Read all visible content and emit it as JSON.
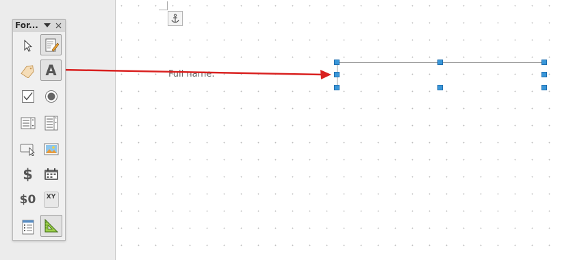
{
  "toolbar": {
    "title": "For...",
    "menu_icon": "chevron-down-icon",
    "close_icon": "close-icon",
    "buttons": [
      {
        "name": "select-icon",
        "active": false
      },
      {
        "name": "design-mode-icon",
        "active": true
      },
      {
        "name": "label-field-icon",
        "active": false
      },
      {
        "name": "text-box-icon",
        "active": true
      },
      {
        "name": "check-box-icon",
        "active": false
      },
      {
        "name": "option-button-icon",
        "active": false
      },
      {
        "name": "list-box-icon",
        "active": false
      },
      {
        "name": "combo-box-icon",
        "active": false
      },
      {
        "name": "push-button-icon",
        "active": false
      },
      {
        "name": "image-button-icon",
        "active": false
      },
      {
        "name": "currency-field-icon",
        "active": false
      },
      {
        "name": "date-field-icon",
        "active": false
      },
      {
        "name": "numeric-field-icon",
        "active": false
      },
      {
        "name": "table-control-icon",
        "active": false
      },
      {
        "name": "form-properties-icon",
        "active": false
      },
      {
        "name": "control-wizards-icon",
        "active": true
      }
    ],
    "glyphs": {
      "text_box": "A",
      "currency": "$",
      "numeric": "$0",
      "xy": "XY"
    }
  },
  "document": {
    "label_text": "Full name:",
    "anchor_icon": "anchor-icon"
  },
  "colors": {
    "arrow": "#d9201f",
    "handle": "#3a97d9",
    "page": "#ffffff"
  }
}
